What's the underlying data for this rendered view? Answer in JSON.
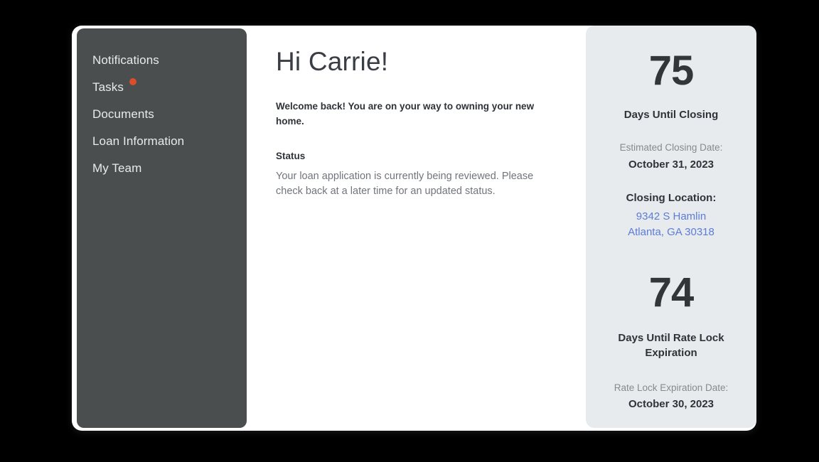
{
  "sidebar": {
    "items": [
      {
        "label": "Notifications",
        "badge": false
      },
      {
        "label": "Tasks",
        "badge": true
      },
      {
        "label": "Documents",
        "badge": false
      },
      {
        "label": "Loan Information",
        "badge": false
      },
      {
        "label": "My Team",
        "badge": false
      }
    ],
    "background_color": "#4a4e4e",
    "badge_color": "#d94f2b"
  },
  "main": {
    "greeting": "Hi Carrie!",
    "welcome_text": "Welcome back!  You are on your way to owning your new home.",
    "status_heading": "Status",
    "status_body": "Your loan application is currently being reviewed. Please check back at a later time for an updated status."
  },
  "stats": {
    "background_color": "#e8ebed",
    "link_color": "#5b7cd8",
    "closing": {
      "number": "75",
      "caption": "Days Until Closing",
      "date_label": "Estimated Closing Date:",
      "date_value": "October 31, 2023",
      "location_label": "Closing Location:",
      "location_line1": "9342 S Hamlin",
      "location_line2": "Atlanta, GA 30318"
    },
    "rate_lock": {
      "number": "74",
      "caption": "Days Until Rate Lock Expiration",
      "date_label": "Rate Lock Expiration Date:",
      "date_value": "October 30, 2023"
    }
  }
}
